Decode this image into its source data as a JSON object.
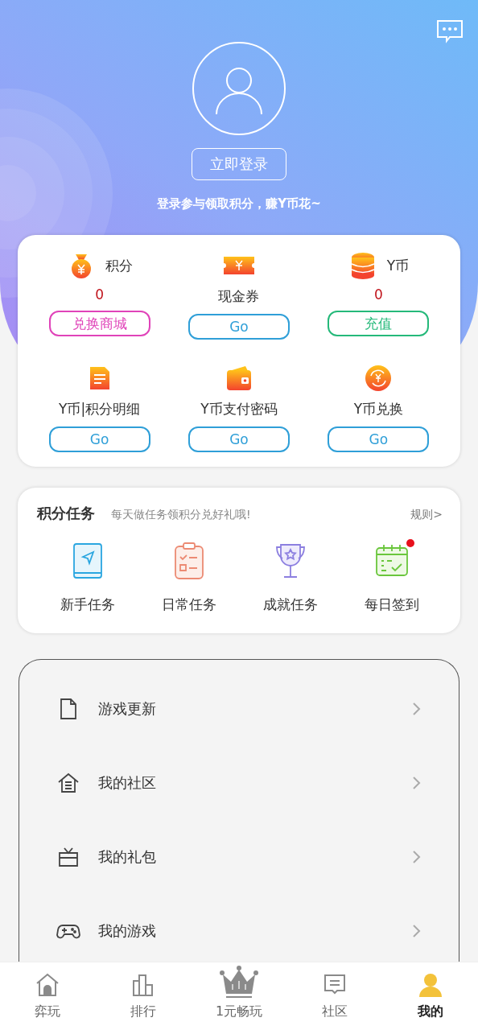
{
  "header": {
    "login_button": "立即登录",
    "prompt": "登录参与领取积分，赚Y币花~"
  },
  "wallet": {
    "items": [
      {
        "kind": "bag",
        "label": "积分",
        "value": "0",
        "button": "兑换商城",
        "color": "#e043b9"
      },
      {
        "kind": "ticket",
        "label": "现金券",
        "button": "Go",
        "color": "#2f9fd8"
      },
      {
        "kind": "coins",
        "label": "Y币",
        "value": "0",
        "button": "充值",
        "color": "#25b97a"
      },
      {
        "kind": "doc",
        "label": "Y币|积分明细",
        "button": "Go",
        "color": "#2f9fd8"
      },
      {
        "kind": "wallet",
        "label": "Y币支付密码",
        "button": "Go",
        "color": "#2f9fd8"
      },
      {
        "kind": "exchange",
        "label": "Y币兑换",
        "button": "Go",
        "color": "#2f9fd8"
      }
    ]
  },
  "tasks": {
    "title": "积分任务",
    "subtitle": "每天做任务领积分兑好礼哦!",
    "rules_link": "规则>",
    "items": [
      {
        "kind": "guide",
        "label": "新手任务",
        "badge": false
      },
      {
        "kind": "clipboard",
        "label": "日常任务",
        "badge": false
      },
      {
        "kind": "trophy",
        "label": "成就任务",
        "badge": false
      },
      {
        "kind": "calendar",
        "label": "每日签到",
        "badge": true
      }
    ]
  },
  "menu": {
    "items": [
      {
        "kind": "file",
        "label": "游戏更新"
      },
      {
        "kind": "house",
        "label": "我的社区"
      },
      {
        "kind": "gift",
        "label": "我的礼包"
      },
      {
        "kind": "gamepad",
        "label": "我的游戏"
      }
    ]
  },
  "bottom_nav": {
    "items": [
      {
        "kind": "home",
        "label": "弈玩",
        "selected": false
      },
      {
        "kind": "rank",
        "label": "排行",
        "selected": false
      },
      {
        "kind": "crown",
        "label": "1元畅玩",
        "selected": false
      },
      {
        "kind": "chat",
        "label": "社区",
        "selected": false
      },
      {
        "kind": "user",
        "label": "我的",
        "selected": true
      }
    ]
  }
}
